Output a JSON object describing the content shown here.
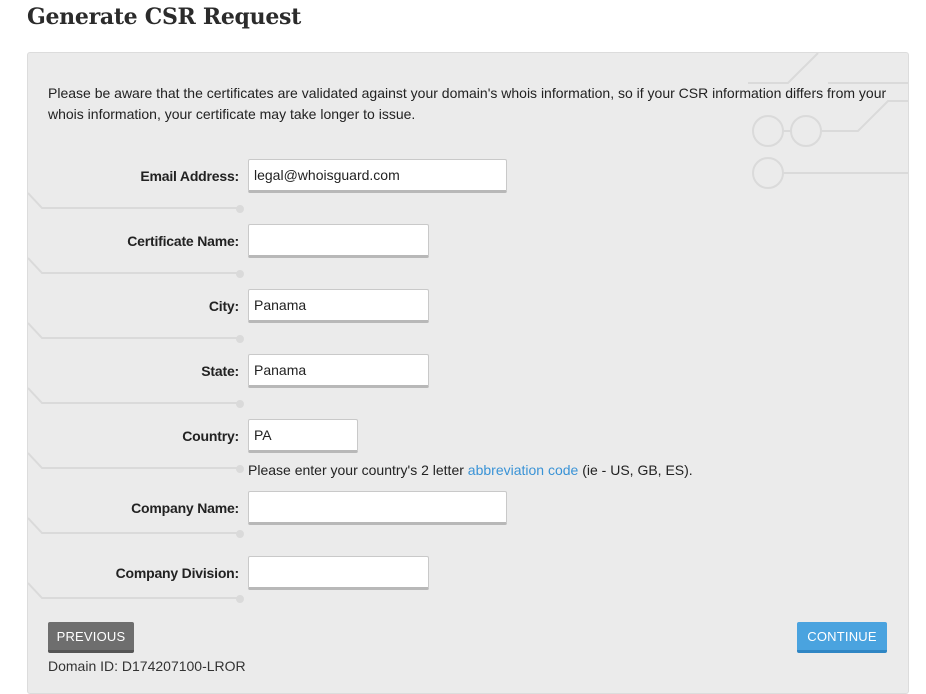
{
  "page": {
    "title": "Generate CSR Request"
  },
  "notice": "Please be aware that the certificates are validated against your domain's whois information, so if your CSR information differs from your whois information, your certificate may take longer to issue.",
  "form": {
    "email": {
      "label": "Email Address:",
      "value": "legal@whoisguard.com"
    },
    "certificate_name": {
      "label": "Certificate Name:",
      "value": ""
    },
    "city": {
      "label": "City:",
      "value": "Panama"
    },
    "state": {
      "label": "State:",
      "value": "Panama"
    },
    "country": {
      "label": "Country:",
      "value": "PA",
      "hint_prefix": "Please enter your country's 2 letter ",
      "hint_link": "abbreviation code",
      "hint_suffix": " (ie - US, GB, ES)."
    },
    "company_name": {
      "label": "Company Name:",
      "value": ""
    },
    "company_division": {
      "label": "Company Division:",
      "value": ""
    }
  },
  "buttons": {
    "previous": "PREVIOUS",
    "continue": "CONTINUE"
  },
  "footer": {
    "domain_id": "Domain ID: D174207100-LROR"
  },
  "colors": {
    "accent": "#4aa3df",
    "link": "#3a93d6",
    "secondary_button": "#6e6e6e",
    "panel_bg": "#ebebeb"
  }
}
